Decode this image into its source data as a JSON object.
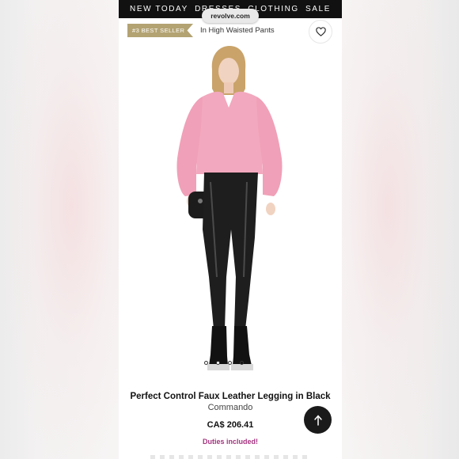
{
  "nav": {
    "items": [
      "NEW TODAY",
      "DRESSES",
      "CLOTHING",
      "SALE"
    ]
  },
  "browser": {
    "url": "revolve.com"
  },
  "badge": {
    "rank": "#3 BEST SELLER",
    "category": "In High Waisted Pants"
  },
  "icons": {
    "favorite": "heart-outline-icon",
    "back_to_top": "arrow-up-icon"
  },
  "gallery": {
    "image_count": 4,
    "active_index": 3
  },
  "product": {
    "name": "Perfect Control Faux Leather Legging in Black",
    "brand": "Commando",
    "price": "CA$ 206.41",
    "duties_note": "Duties included!"
  },
  "colors": {
    "nav_bg": "#111111",
    "badge_gold": "#b3a372",
    "duties_accent": "#a4347f",
    "sweater_pink": "#f2a8be"
  }
}
